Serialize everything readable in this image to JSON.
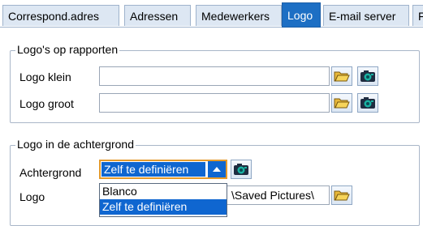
{
  "tabs": [
    {
      "label": "Correspond.adres",
      "active": false
    },
    {
      "label": "Adressen",
      "active": false
    },
    {
      "label": "Medewerkers",
      "active": false
    },
    {
      "label": "Logo",
      "active": true
    },
    {
      "label": "E-mail server",
      "active": false
    },
    {
      "label": "F",
      "active": false
    }
  ],
  "report_logos": {
    "title": "Logo's op rapporten",
    "small_label": "Logo klein",
    "small_value": "",
    "large_label": "Logo groot",
    "large_value": ""
  },
  "background_logo": {
    "title": "Logo in de achtergrond",
    "background_label": "Achtergrond",
    "background_value": "Zelf te definiëren",
    "logo_label": "Logo",
    "logo_value": "\\Saved Pictures\\",
    "options": [
      "Blanco",
      "Zelf te definiëren"
    ],
    "selected_option": "Zelf te definiëren"
  },
  "icons": {
    "open": "open-folder-icon",
    "preview": "camera-preview-icon",
    "arrow": "arrow-up-icon"
  },
  "colors": {
    "active_tab": "#1d6fc4",
    "selection": "#0f66d0",
    "focus_border": "#e59a2b"
  }
}
